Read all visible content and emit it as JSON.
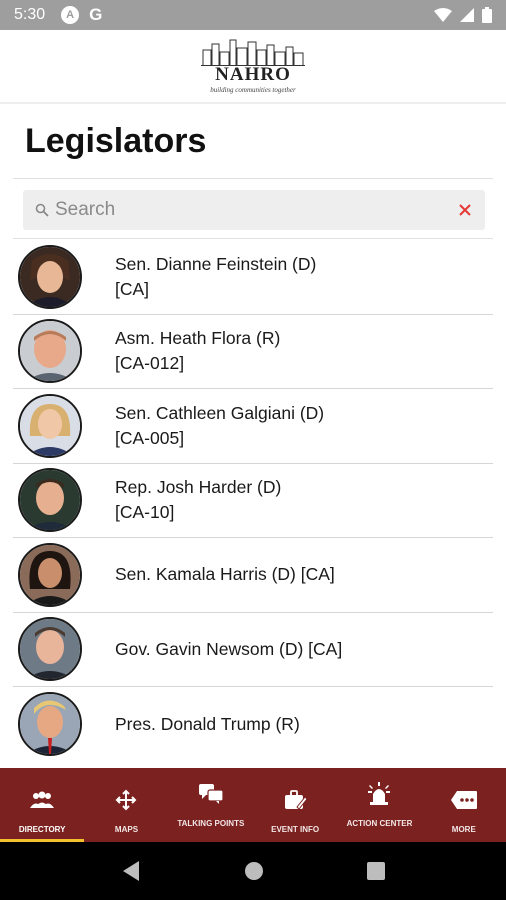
{
  "status_bar": {
    "time": "5:30",
    "app_icon_letter": "A",
    "google_letter": "G"
  },
  "header": {
    "logo_name": "NAHRO",
    "logo_tagline": "building communities together"
  },
  "page": {
    "title": "Legislators"
  },
  "search": {
    "placeholder": "Search",
    "value": ""
  },
  "legislators": [
    {
      "line1": "Sen. Dianne Feinstein (D)",
      "line2": "[CA]"
    },
    {
      "line1": "Asm. Heath Flora (R)",
      "line2": "[CA-012]"
    },
    {
      "line1": "Sen. Cathleen Galgiani (D)",
      "line2": "[CA-005]"
    },
    {
      "line1": "Rep. Josh Harder (D)",
      "line2": "[CA-10]"
    },
    {
      "line1": "Sen. Kamala Harris (D) [CA]",
      "line2": ""
    },
    {
      "line1": "Gov. Gavin Newsom (D) [CA]",
      "line2": ""
    },
    {
      "line1": "Pres. Donald Trump (R)",
      "line2": ""
    }
  ],
  "bottom_nav": {
    "tabs": [
      {
        "label": "DIRECTORY",
        "icon": "people-icon",
        "active": true
      },
      {
        "label": "MAPS",
        "icon": "move-arrows-icon",
        "active": false
      },
      {
        "label": "TALKING POINTS",
        "icon": "chat-bubbles-icon",
        "active": false
      },
      {
        "label": "EVENT INFO",
        "icon": "briefcase-icon",
        "active": false
      },
      {
        "label": "ACTION CENTER",
        "icon": "alarm-light-icon",
        "active": false
      },
      {
        "label": "MORE",
        "icon": "more-tag-icon",
        "active": false
      }
    ]
  },
  "colors": {
    "nav_bg": "#7b2220",
    "active_indicator": "#f2c12e",
    "status_bar": "#9e9e9e",
    "clear_x": "#e53935"
  }
}
